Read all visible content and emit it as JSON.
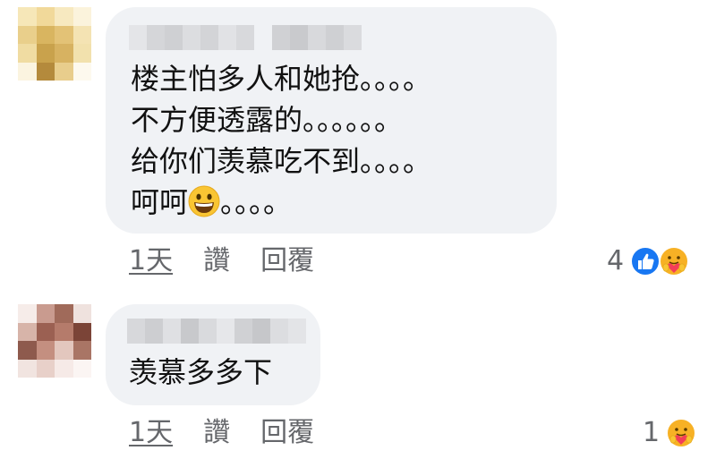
{
  "comments": [
    {
      "author_name_visible": false,
      "lines": [
        "楼主怕多人和她抢。。。。",
        "不方便透露的。。。。。。",
        "给你们羡慕吃不到。。。。"
      ],
      "last_line_before_emoji": "呵呵",
      "last_line_after_emoji": "。。。。",
      "emoji": "grinning-face-emoji",
      "time": "1天",
      "like_label": "讚",
      "reply_label": "回覆",
      "reaction_count": "4",
      "reactions": [
        "like-reaction-icon",
        "care-reaction-icon"
      ]
    },
    {
      "author_name_visible": false,
      "lines": [
        "羡慕多多下"
      ],
      "time": "1天",
      "like_label": "讚",
      "reply_label": "回覆",
      "reaction_count": "1",
      "reactions": [
        "care-reaction-icon"
      ]
    }
  ],
  "colors": {
    "bubble": "#f0f2f5",
    "meta_text": "#65676b",
    "like_blue": "#1877f2",
    "care_yellow": "#f7b125"
  }
}
